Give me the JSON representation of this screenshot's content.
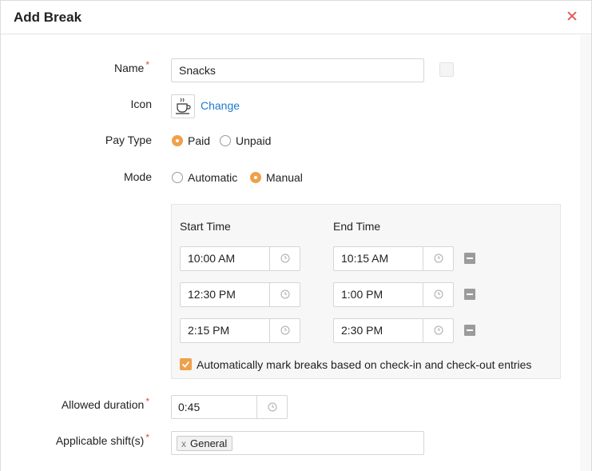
{
  "dialog": {
    "title": "Add Break",
    "close_icon": "close-icon"
  },
  "form": {
    "name_label": "Name",
    "name_value": "Snacks",
    "required_mark": "*",
    "icon_label": "Icon",
    "icon_name": "coffee-cup-icon",
    "change_link": "Change",
    "pay_type_label": "Pay Type",
    "pay_type_options": [
      {
        "label": "Paid",
        "selected": true
      },
      {
        "label": "Unpaid",
        "selected": false
      }
    ],
    "mode_label": "Mode",
    "mode_options": [
      {
        "label": "Automatic",
        "selected": false
      },
      {
        "label": "Manual",
        "selected": true
      }
    ]
  },
  "schedule": {
    "start_header": "Start Time",
    "end_header": "End Time",
    "rows": [
      {
        "start": "10:00 AM",
        "end": "10:15 AM"
      },
      {
        "start": "12:30 PM",
        "end": "1:00 PM"
      },
      {
        "start": "2:15 PM",
        "end": "2:30 PM"
      }
    ],
    "auto_mark_checked": true,
    "auto_mark_label": "Automatically mark breaks based on check-in and check-out entries"
  },
  "duration": {
    "label": "Allowed duration",
    "value": "0:45"
  },
  "shifts": {
    "label": "Applicable shift(s)",
    "tags": [
      "General"
    ],
    "remove_glyph": "x"
  },
  "colors": {
    "accent": "#f0a04b",
    "link": "#1f7acb",
    "required": "#e0473f",
    "close": "#e35a5a"
  }
}
